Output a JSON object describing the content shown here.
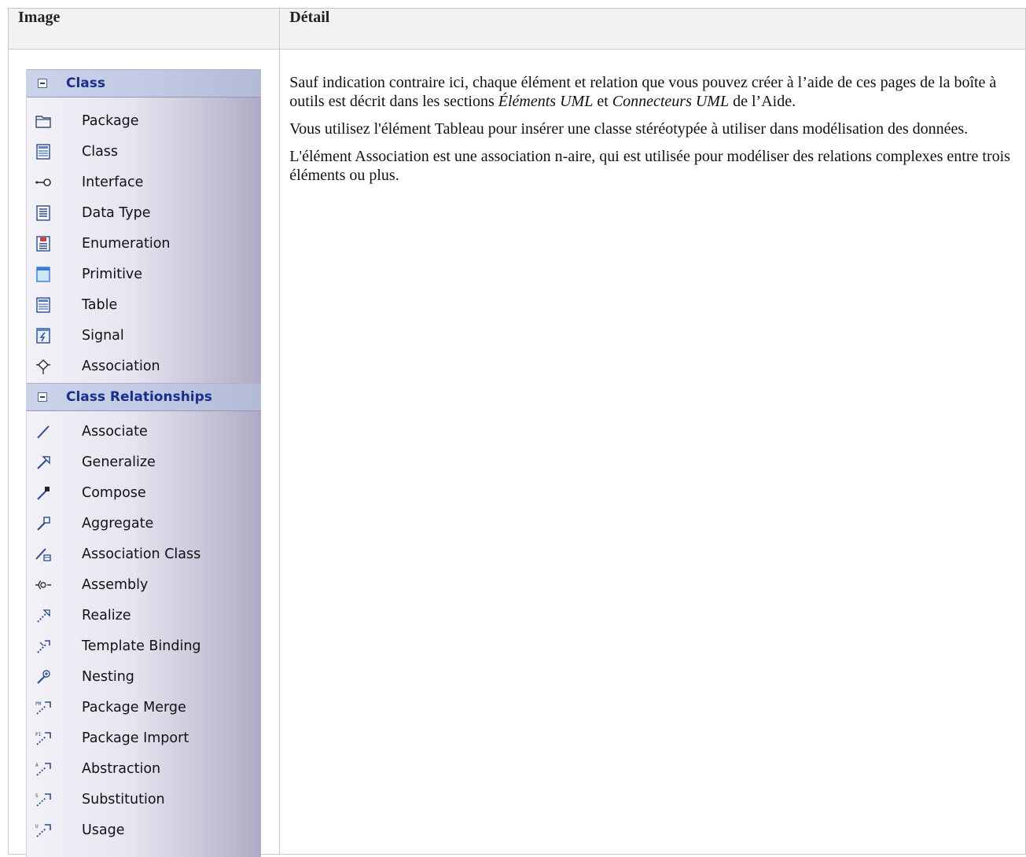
{
  "table": {
    "headers": [
      "Image",
      "Détail"
    ]
  },
  "toolbox": {
    "sections": [
      {
        "title": "Class",
        "items": [
          {
            "label": "Package",
            "icon": "package-icon"
          },
          {
            "label": "Class",
            "icon": "class-icon"
          },
          {
            "label": "Interface",
            "icon": "interface-icon"
          },
          {
            "label": "Data Type",
            "icon": "data-type-icon"
          },
          {
            "label": "Enumeration",
            "icon": "enumeration-icon"
          },
          {
            "label": "Primitive",
            "icon": "primitive-icon"
          },
          {
            "label": "Table",
            "icon": "table-icon"
          },
          {
            "label": "Signal",
            "icon": "signal-icon"
          },
          {
            "label": "Association",
            "icon": "association-diamond-icon"
          }
        ]
      },
      {
        "title": "Class Relationships",
        "items": [
          {
            "label": "Associate",
            "icon": "associate-icon"
          },
          {
            "label": "Generalize",
            "icon": "generalize-icon"
          },
          {
            "label": "Compose",
            "icon": "compose-icon"
          },
          {
            "label": "Aggregate",
            "icon": "aggregate-icon"
          },
          {
            "label": "Association Class",
            "icon": "association-class-icon"
          },
          {
            "label": "Assembly",
            "icon": "assembly-icon"
          },
          {
            "label": "Realize",
            "icon": "realize-icon"
          },
          {
            "label": "Template Binding",
            "icon": "template-binding-icon"
          },
          {
            "label": "Nesting",
            "icon": "nesting-icon"
          },
          {
            "label": "Package Merge",
            "icon": "package-merge-icon"
          },
          {
            "label": "Package Import",
            "icon": "package-import-icon"
          },
          {
            "label": "Abstraction",
            "icon": "abstraction-icon"
          },
          {
            "label": "Substitution",
            "icon": "substitution-icon"
          },
          {
            "label": "Usage",
            "icon": "usage-icon"
          }
        ]
      }
    ]
  },
  "detail": {
    "p1_a": "Sauf indication contraire ici, chaque élément et relation que vous pouvez créer à l’aide de ces pages de la boîte à outils est décrit dans les sections ",
    "p1_em1": "Éléments UML",
    "p1_b": " et ",
    "p1_em2": "Connecteurs UML",
    "p1_c": " de l’Aide.",
    "p2": "Vous utilisez l'élément Tableau pour insérer une classe stéréotypée à utiliser dans modélisation des données.",
    "p3": "L'élément Association est une association n-aire, qui est utilisée pour modéliser des relations complexes entre trois éléments ou plus."
  },
  "colors": {
    "header_title": "#1b2d8a",
    "table_header_bg": "#f2f2f2",
    "border": "#c8c8c8"
  }
}
